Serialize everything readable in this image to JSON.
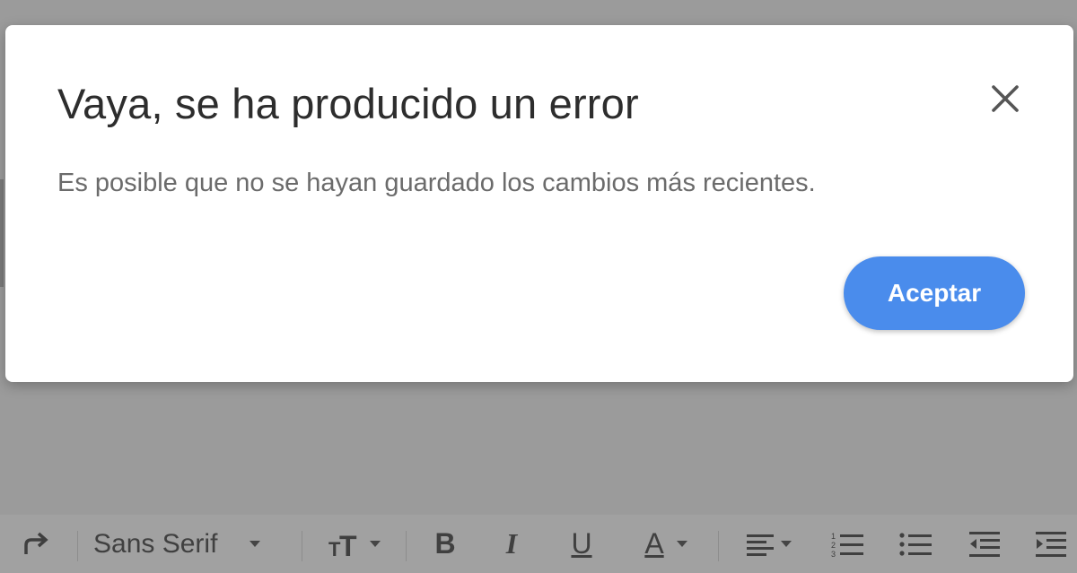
{
  "dialog": {
    "title": "Vaya, se ha producido un error",
    "message": "Es posible que no se hayan guardado los cambios más recientes.",
    "accept_label": "Aceptar",
    "accent_color": "#4a8cec",
    "close_icon": "close-icon"
  },
  "toolbar": {
    "redo_icon": "redo-icon",
    "font_family": "Sans Serif",
    "font_size_icon": "text-size-icon",
    "bold": "B",
    "italic": "I",
    "underline": "U",
    "text_color": "A",
    "align_icon": "align-left-icon",
    "numbered_list_icon": "numbered-list-icon",
    "bulleted_list_icon": "bulleted-list-icon",
    "indent_less_icon": "indent-less-icon",
    "indent_more_icon": "indent-more-icon"
  }
}
